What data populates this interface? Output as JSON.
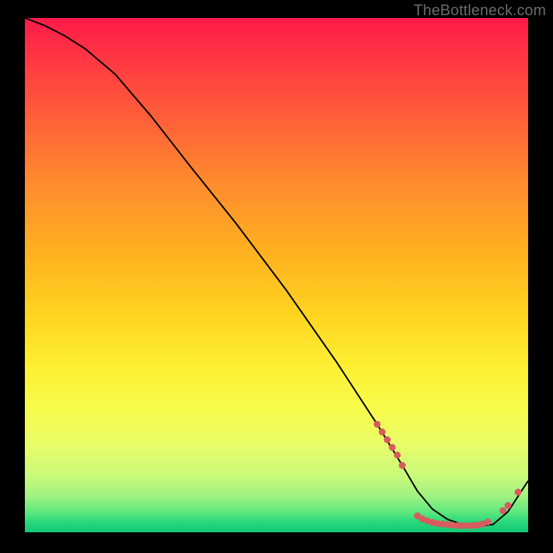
{
  "watermark": "TheBottleneck.com",
  "chart_data": {
    "type": "line",
    "title": "",
    "xlabel": "",
    "ylabel": "",
    "xlim": [
      0,
      100
    ],
    "ylim": [
      0,
      100
    ],
    "grid": false,
    "legend": false,
    "background": "red-yellow-green vertical gradient",
    "x": [
      0,
      4,
      8,
      12,
      18,
      25,
      33,
      42,
      52,
      62,
      70,
      75,
      78,
      81,
      84,
      87,
      90,
      93,
      96,
      100
    ],
    "y": [
      100,
      98.5,
      96.5,
      94,
      89,
      81,
      71,
      60,
      47,
      33,
      21,
      13,
      8,
      4.5,
      2.5,
      1.5,
      1.2,
      1.5,
      4,
      10
    ],
    "dots": [
      {
        "x": 70,
        "y": 21
      },
      {
        "x": 71,
        "y": 19.5
      },
      {
        "x": 72,
        "y": 18
      },
      {
        "x": 73,
        "y": 16.5
      },
      {
        "x": 74,
        "y": 15
      },
      {
        "x": 75,
        "y": 13
      },
      {
        "x": 78,
        "y": 3.2
      },
      {
        "x": 79,
        "y": 2.6
      },
      {
        "x": 80,
        "y": 2.2
      },
      {
        "x": 81,
        "y": 1.9
      },
      {
        "x": 82,
        "y": 1.7
      },
      {
        "x": 83,
        "y": 1.6
      },
      {
        "x": 84,
        "y": 1.5
      },
      {
        "x": 85,
        "y": 1.4
      },
      {
        "x": 86,
        "y": 1.3
      },
      {
        "x": 87,
        "y": 1.3
      },
      {
        "x": 88,
        "y": 1.3
      },
      {
        "x": 89,
        "y": 1.3
      },
      {
        "x": 90,
        "y": 1.4
      },
      {
        "x": 91,
        "y": 1.6
      },
      {
        "x": 92,
        "y": 2.0
      },
      {
        "x": 95,
        "y": 4.2
      },
      {
        "x": 96,
        "y": 5.2
      },
      {
        "x": 98,
        "y": 7.8
      }
    ]
  }
}
